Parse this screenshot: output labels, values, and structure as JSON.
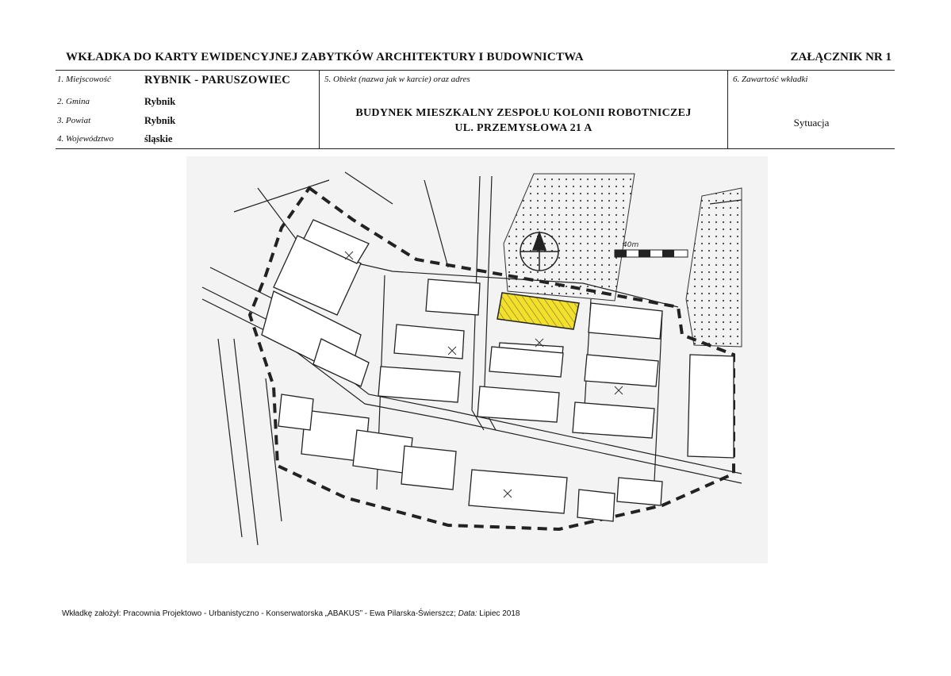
{
  "header": {
    "title": "WKŁADKA DO KARTY EWIDENCYJNEJ ZABYTKÓW ARCHITEKTURY I BUDOWNICTWA",
    "annex": "ZAŁĄCZNIK NR 1"
  },
  "fields": {
    "locality_label": "1. Miejscowość",
    "locality_value": "RYBNIK - PARUSZOWIEC",
    "commune_label": "2. Gmina",
    "commune_value": "Rybnik",
    "district_label": "3. Powiat",
    "district_value": "Rybnik",
    "voivodeship_label": "4. Województwo",
    "voivodeship_value": "śląskie",
    "object_label": "5. Obiekt (nazwa jak w karcie) oraz adres",
    "object_line1": "BUDYNEK MIESZKALNY ZESPOŁU KOLONII ROBOTNICZEJ",
    "object_line2": "UL. PRZEMYSŁOWA 21 A",
    "content_label": "6. Zawartość wkładki",
    "content_value": "Sytuacja"
  },
  "map": {
    "scale_label": "40m",
    "highlight_color": "#f2e02a",
    "line_color": "#222222"
  },
  "footer": {
    "prefix": "Wkładkę założył: Pracownia Projektowo - Urbanistyczno - Konserwatorska „ABAKUS” - Ewa Pilarska-Świerszcz;",
    "date_label": "Data:",
    "date_value": "Lipiec 2018"
  }
}
